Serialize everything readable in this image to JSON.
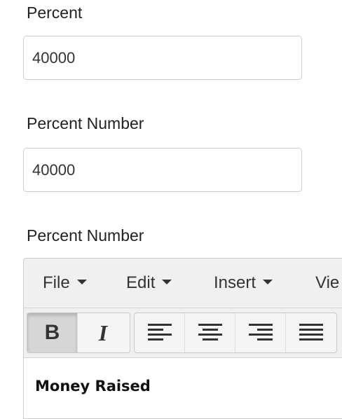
{
  "fields": [
    {
      "label": "Percent",
      "value": "40000"
    },
    {
      "label": "Percent Number",
      "value": "40000"
    }
  ],
  "editor": {
    "label": "Percent Number",
    "menu": {
      "file": "File",
      "edit": "Edit",
      "insert": "Insert",
      "view": "Vie"
    },
    "toolbar": {
      "bold": "B",
      "italic": "I",
      "active": "bold",
      "icons": [
        "bold-icon",
        "italic-icon",
        "align-left-icon",
        "align-center-icon",
        "align-right-icon",
        "align-justify-icon"
      ]
    },
    "content_heading": "Money Raised"
  }
}
